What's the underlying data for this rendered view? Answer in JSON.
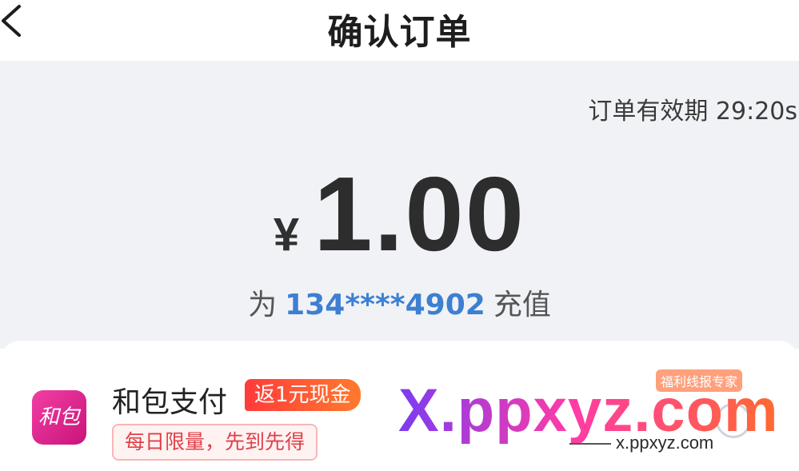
{
  "header": {
    "title": "确认订单",
    "back_icon": "chevron-left-icon"
  },
  "order": {
    "expire_text": "订单有效期 29:20s",
    "currency_symbol": "¥",
    "amount": "1.00",
    "recharge_prefix": "为",
    "phone": "134****4902",
    "recharge_suffix": "充值"
  },
  "payment": {
    "logo_text": "和包",
    "name": "和包支付",
    "cashback_badge": "返1元现金",
    "limit_tag": "每日限量，先到先得",
    "selected": false
  },
  "watermark": {
    "big": "X.ppxyz.com",
    "small": "x.ppxyz.com",
    "badge": "福利线报专家"
  },
  "colors": {
    "panel_bg": "#f0f2f6",
    "phone_blue": "#3d7fd1",
    "cashback_red": "#ff3b3b",
    "hebao_pink": "#e0268f"
  }
}
